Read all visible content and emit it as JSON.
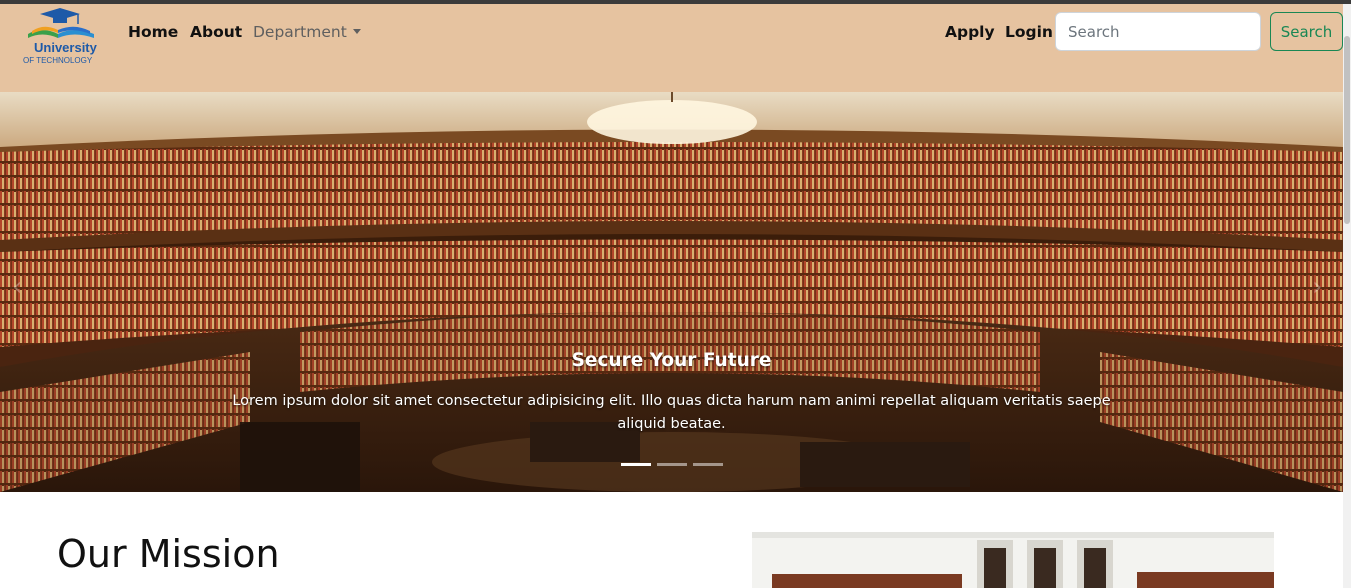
{
  "navbar": {
    "logo": {
      "line1": "University",
      "line2": "OF TECHNOLOGY",
      "icon": "graduation-cap-book-icon"
    },
    "links": {
      "home": "Home",
      "about": "About",
      "department": "Department",
      "apply": "Apply",
      "login": "Login"
    },
    "search": {
      "placeholder": "Search",
      "value": "",
      "button_label": "Search"
    }
  },
  "carousel": {
    "caption_title": "Secure Your Future",
    "caption_text": "Lorem ipsum dolor sit amet consectetur adipisicing elit. Illo quas dicta harum nam animi repellat aliquam veritatis saepe aliquid beatae.",
    "active_slide": 1,
    "slide_count": 3
  },
  "mission": {
    "title": "Our Mission"
  },
  "colors": {
    "navbar_bg": "#e6c3a0",
    "search_accent": "#198754"
  }
}
